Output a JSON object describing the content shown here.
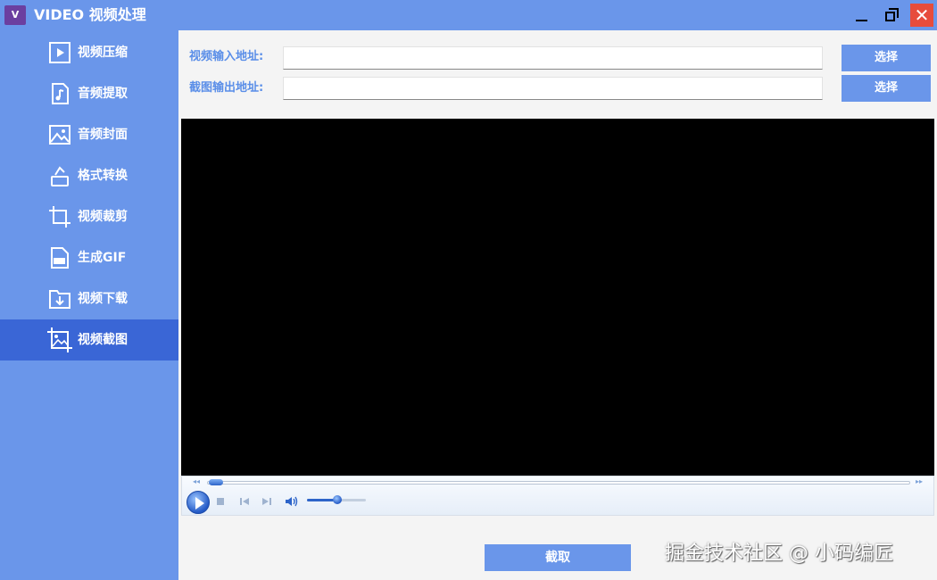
{
  "window": {
    "logo_text": "V",
    "title": "VIDEO 视频处理",
    "close_glyph": "✕"
  },
  "sidebar": {
    "items": [
      {
        "label": "视频压缩",
        "icon": "play-square-icon",
        "active": false
      },
      {
        "label": "音频提取",
        "icon": "music-note-icon",
        "active": false
      },
      {
        "label": "音频封面",
        "icon": "image-icon",
        "active": false
      },
      {
        "label": "格式转换",
        "icon": "convert-icon",
        "active": false
      },
      {
        "label": "视频裁剪",
        "icon": "crop-icon",
        "active": false
      },
      {
        "label": "生成GIF",
        "icon": "gif-file-icon",
        "active": false
      },
      {
        "label": "视频下载",
        "icon": "download-folder-icon",
        "active": false
      },
      {
        "label": "视频截图",
        "icon": "screenshot-crop-icon",
        "active": true
      }
    ]
  },
  "form": {
    "input_label": "视频输入地址:",
    "input_value": "",
    "output_label": "截图输出地址:",
    "output_value": "",
    "pick_label": "选择"
  },
  "player": {
    "seek_back_glyph": "◂◂",
    "seek_fwd_glyph": "▸▸",
    "progress": 0.0,
    "volume": 0.5
  },
  "actions": {
    "capture_label": "截取"
  },
  "watermark": "掘金技术社区 @ 小码编匠",
  "colors": {
    "accent": "#6a96ea",
    "active": "#3a66d6",
    "label": "#5a8ee8",
    "close": "#e74c3c"
  }
}
